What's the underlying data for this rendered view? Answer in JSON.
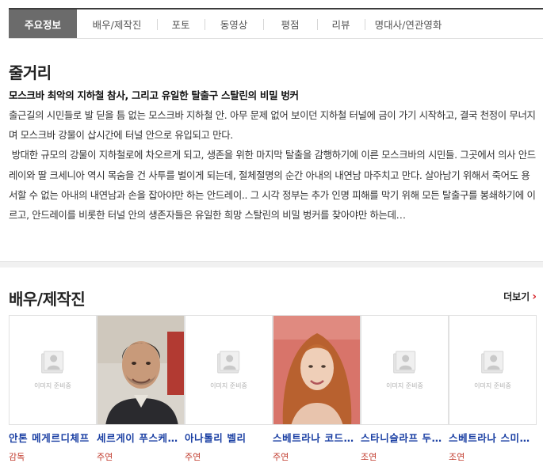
{
  "tabs": [
    {
      "label": "주요정보",
      "active": true
    },
    {
      "label": "배우/제작진",
      "active": false
    },
    {
      "label": "포토",
      "active": false
    },
    {
      "label": "동영상",
      "active": false
    },
    {
      "label": "평점",
      "active": false
    },
    {
      "label": "리뷰",
      "active": false
    },
    {
      "label": "명대사/연관영화",
      "active": false
    }
  ],
  "synopsis": {
    "heading": "줄거리",
    "subtitle": "모스크바 최악의 지하철 참사, 그리고 유일한 탈출구 스탈린의 비밀 벙커",
    "paragraphs": [
      "출근길의 시민들로 발 딛을 틈 없는 모스크바 지하철 안. 아무 문제 없어 보이던 지하철 터널에 금이 가기 시작하고, 결국 천정이 무너지며 모스크바 강물이 삽시간에 터널 안으로 유입되고 만다.",
      " 방대한 규모의 강물이 지하철로에 차오르게 되고, 생존을 위한 마지막 탈출을 감행하기에 이른 모스크바의 시민들. 그곳에서 의사 안드레이와 딸 크세니아 역시 목숨을 건 사투를 벌이게 되는데, 절체절명의 순간 아내의 내연남 마주치고 만다. 살아남기 위해서 죽어도 용서할 수 없는 아내의 내연남과 손을 잡아야만 하는 안드레이.. 그 시각 정부는 추가 인명 피해를 막기 위해 모든 탈출구를 봉쇄하기에 이르고, 안드레이를 비롯한 터널 안의 생존자들은 유일한 희망 스탈린의 비밀 벙커를 찾아야만 하는데…"
    ]
  },
  "cast": {
    "heading": "배우/제작진",
    "more_label": "더보기",
    "placeholder_text": "이미지 준비중",
    "people": [
      {
        "name": "안톤 메게르디체프",
        "role": "감독",
        "photo": "placeholder"
      },
      {
        "name": "세르게이 푸스케파리스",
        "role": "주연",
        "photo": "man"
      },
      {
        "name": "아나톨리 벨리",
        "role": "주연",
        "photo": "placeholder"
      },
      {
        "name": "스베트라나 코드첸코바",
        "role": "주연",
        "photo": "woman"
      },
      {
        "name": "스타니슬라프 두진니코프",
        "role": "조연",
        "photo": "placeholder"
      },
      {
        "name": "스베트라나 스미르노바",
        "role": "조연",
        "photo": "placeholder"
      }
    ]
  },
  "colors": {
    "accent_red": "#d8272d",
    "link_blue": "#1a3fa3",
    "role_red": "#c0392b",
    "active_tab_bg": "#6b6b6b"
  }
}
